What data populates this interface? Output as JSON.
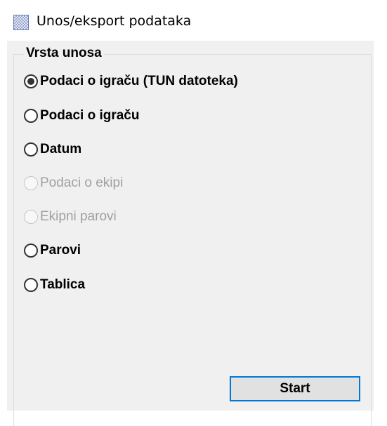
{
  "window": {
    "title": "Unos/eksport podataka",
    "icon": "app-window-icon"
  },
  "group": {
    "label": "Vrsta unosa",
    "options": [
      {
        "label": "Podaci o igraču (TUN datoteka)",
        "checked": true,
        "enabled": true
      },
      {
        "label": "Podaci o igraču",
        "checked": false,
        "enabled": true
      },
      {
        "label": "Datum",
        "checked": false,
        "enabled": true
      },
      {
        "label": "Podaci o ekipi",
        "checked": false,
        "enabled": false
      },
      {
        "label": "Ekipni parovi",
        "checked": false,
        "enabled": false
      },
      {
        "label": "Parovi",
        "checked": false,
        "enabled": true
      },
      {
        "label": "Tablica",
        "checked": false,
        "enabled": true
      }
    ]
  },
  "actions": {
    "start_label": "Start"
  },
  "colors": {
    "panel_background": "#f0f0f0",
    "button_focus_border": "#0078d7",
    "disabled_text": "#a0a0a0"
  }
}
